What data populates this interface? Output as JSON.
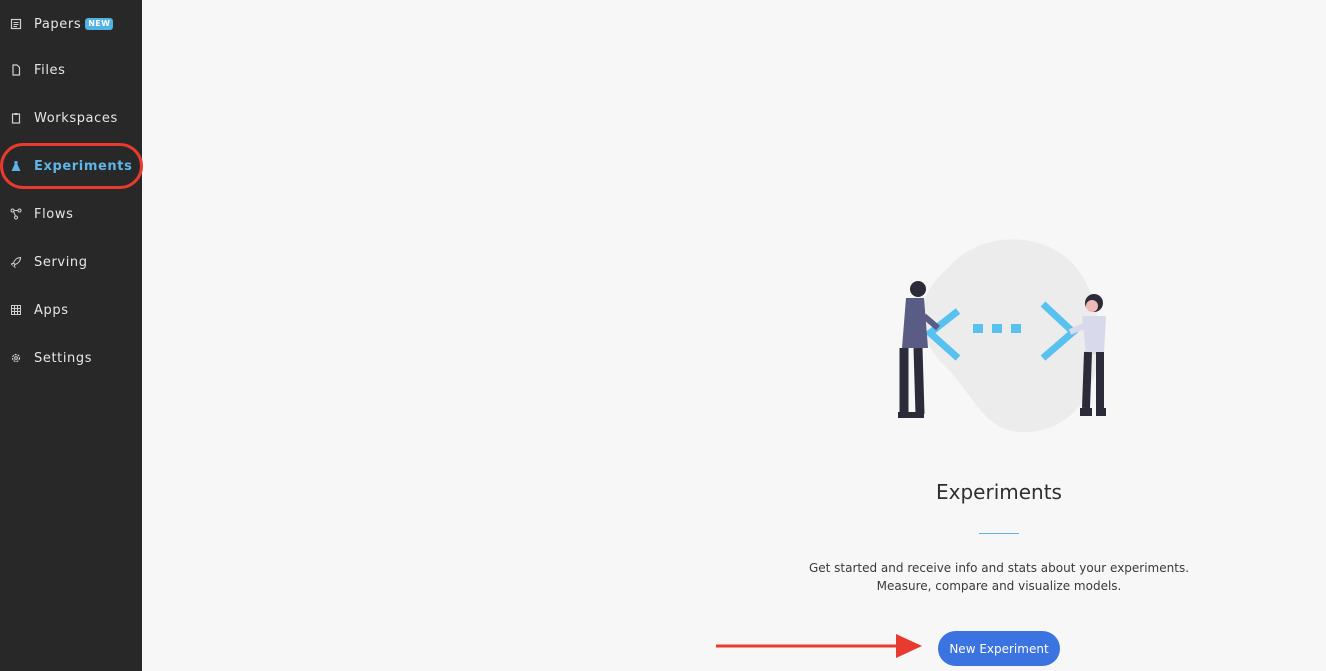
{
  "sidebar": {
    "items": [
      {
        "label": "Papers",
        "icon": "papers-icon",
        "badge": "NEW"
      },
      {
        "label": "Files",
        "icon": "file-icon"
      },
      {
        "label": "Workspaces",
        "icon": "clipboard-icon"
      },
      {
        "label": "Experiments",
        "icon": "flask-icon",
        "active": true
      },
      {
        "label": "Flows",
        "icon": "flow-icon"
      },
      {
        "label": "Serving",
        "icon": "rocket-icon"
      },
      {
        "label": "Apps",
        "icon": "grid-icon"
      },
      {
        "label": "Settings",
        "icon": "gear-icon"
      }
    ]
  },
  "main": {
    "title": "Experiments",
    "description_line1": "Get started and receive info and stats about your experiments.",
    "description_line2": "Measure, compare and visualize models.",
    "cta_label": "New Experiment"
  },
  "colors": {
    "sidebar_bg": "#282828",
    "accent": "#5eb4e6",
    "button": "#3b73e0",
    "annotation": "#e83a2f"
  }
}
